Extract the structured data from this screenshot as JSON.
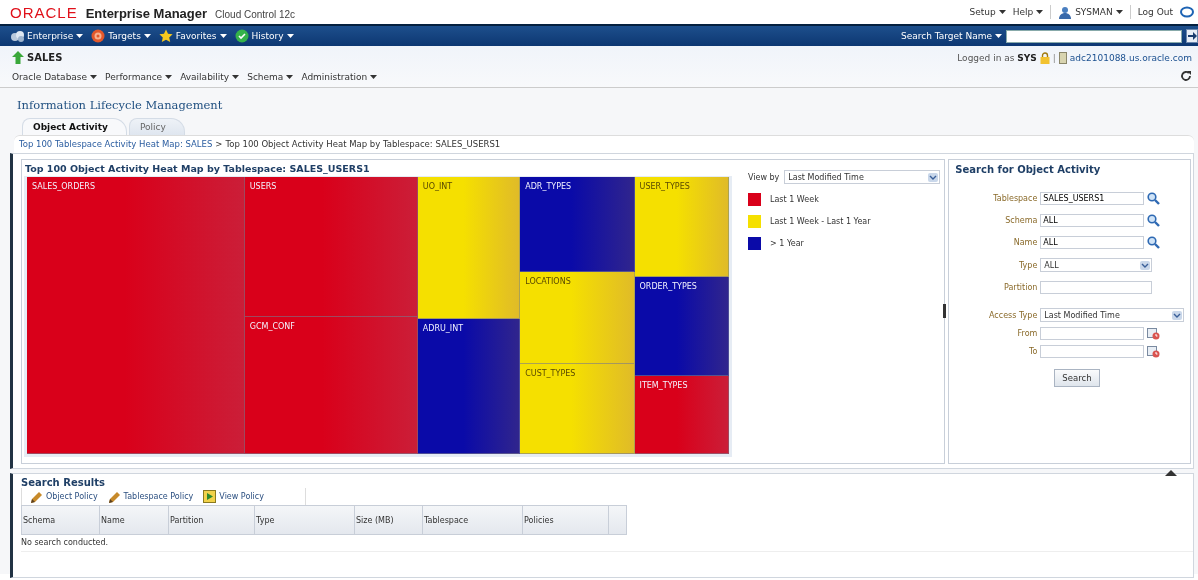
{
  "header": {
    "logo": "ORACLE",
    "product": "Enterprise Manager",
    "edition": "Cloud Control 12c",
    "links": [
      {
        "label": "Setup",
        "kind": "menu"
      },
      {
        "label": "Help",
        "kind": "menu"
      },
      {
        "label": "SYSMAN",
        "kind": "user"
      },
      {
        "label": "Log Out",
        "kind": "link"
      }
    ]
  },
  "navbar": {
    "menus": [
      {
        "label": "Enterprise",
        "kind": "cloud"
      },
      {
        "label": "Targets",
        "kind": "target"
      },
      {
        "label": "Favorites",
        "kind": "star"
      },
      {
        "label": "History",
        "kind": "history"
      }
    ],
    "search_label": "Search Target Name"
  },
  "target": {
    "name": "SALES",
    "menus": [
      "Oracle Database",
      "Performance",
      "Availability",
      "Schema",
      "Administration"
    ],
    "logged_in_label": "Logged in as",
    "user": "SYS",
    "separator": "|",
    "host": "adc2101088.us.oracle.com"
  },
  "page_title": "Information Lifecycle Management",
  "tabs": [
    {
      "label": "Object Activity",
      "selected": true
    },
    {
      "label": "Policy",
      "selected": false
    }
  ],
  "breadcrumb": {
    "link": "Top 100 Tablespace Activity Heat Map: SALES",
    "separator": ">",
    "current": "Top 100 Object Activity Heat Map by Tablespace: SALES_USERS1"
  },
  "heatmap": {
    "title": "Top 100 Object Activity Heat Map by Tablespace: SALES_USERS1",
    "columns": [
      [
        {
          "label": "SALES_ORDERS",
          "kind": "week"
        }
      ],
      [
        {
          "label": "USERS",
          "kind": "week"
        },
        {
          "label": "GCM_CONF",
          "kind": "week"
        }
      ],
      [
        {
          "label": "UO_INT",
          "kind": "year"
        },
        {
          "label": "ADRU_INT",
          "kind": "older"
        }
      ],
      [
        {
          "label": "ADR_TYPES",
          "kind": "older"
        },
        {
          "label": "LOCATIONS",
          "kind": "year"
        },
        {
          "label": "CUST_TYPES",
          "kind": "year"
        }
      ],
      [
        {
          "label": "USER_TYPES",
          "kind": "year"
        },
        {
          "label": "ORDER_TYPES",
          "kind": "older"
        },
        {
          "label": "ITEM_TYPES",
          "kind": "week"
        }
      ]
    ]
  },
  "view_by": {
    "label": "View by",
    "value": "Last Modified Time"
  },
  "legend": [
    {
      "label": "Last 1 Week",
      "kind": "week",
      "color": "#d9001a"
    },
    {
      "label": "Last 1 Week - Last 1 Year",
      "kind": "year",
      "color": "#f5e000"
    },
    {
      "label": "> 1 Year",
      "kind": "older",
      "color": "#0a0aa8"
    }
  ],
  "search_panel": {
    "title": "Search for Object Activity",
    "fields": [
      {
        "label": "Tablespace",
        "value": "SALES_USERS1",
        "kind": "lookup"
      },
      {
        "label": "Schema",
        "value": "ALL",
        "kind": "lookup"
      },
      {
        "label": "Name",
        "value": "ALL",
        "kind": "lookup"
      },
      {
        "label": "Type",
        "value": "ALL",
        "kind": "select"
      },
      {
        "label": "Partition",
        "kind": "text"
      },
      {
        "label": "Access Type",
        "value": "Last Modified Time",
        "kind": "select"
      },
      {
        "label": "From",
        "kind": "date"
      },
      {
        "label": "To",
        "kind": "date"
      }
    ],
    "button": "Search"
  },
  "results": {
    "title": "Search Results",
    "actions": [
      {
        "label": "Object Policy",
        "kind": "edit"
      },
      {
        "label": "Tablespace Policy",
        "kind": "edit"
      },
      {
        "label": "View Policy",
        "kind": "view"
      }
    ],
    "columns": [
      "Schema",
      "Name",
      "Partition",
      "Type",
      "Size (MB)",
      "Tablespace",
      "Policies"
    ],
    "empty_text": "No search conducted."
  }
}
